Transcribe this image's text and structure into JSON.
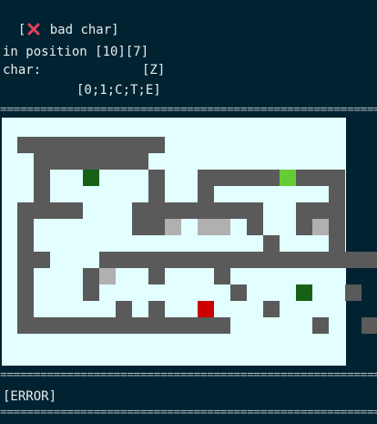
{
  "header": {
    "bracket_open": "[",
    "title": "bad char]",
    "status_icon": "x-icon"
  },
  "info": {
    "position_line": "in position [10][7]",
    "char_label": "char:",
    "char_value": "[Z]",
    "allowed_chars": "[0;1;C;T;E]"
  },
  "separator": "================================================================",
  "footer": {
    "error_label": "[ERROR]"
  },
  "colors": {
    "background": "#012331",
    "panel": "#e2fefe",
    "wall": "#5a5a5a",
    "visited": "#b0b0b0",
    "current": "#cc0000",
    "goal": "#66cc33",
    "marker": "#176117",
    "x_icon": "#e5415d"
  },
  "maze": {
    "rows": [
      "#########..............",
      ".#######..............",
      ".#..T...#..#####E###..",
      ".#......#..#.......#..",
      "####...########..###..",
      "#......##V.VV.#..#V#..",
      "#..............#...#..",
      "##...##################",
      "#...#V..#...#.........",
      "#...#........#...T..#..",
      "#.....#.#..C...#......#",
      "#############.....#..##"
    ],
    "legend": {
      "#": "wall",
      ".": "open",
      "V": "visited",
      "C": "current",
      "E": "goal",
      "T": "marker"
    }
  }
}
